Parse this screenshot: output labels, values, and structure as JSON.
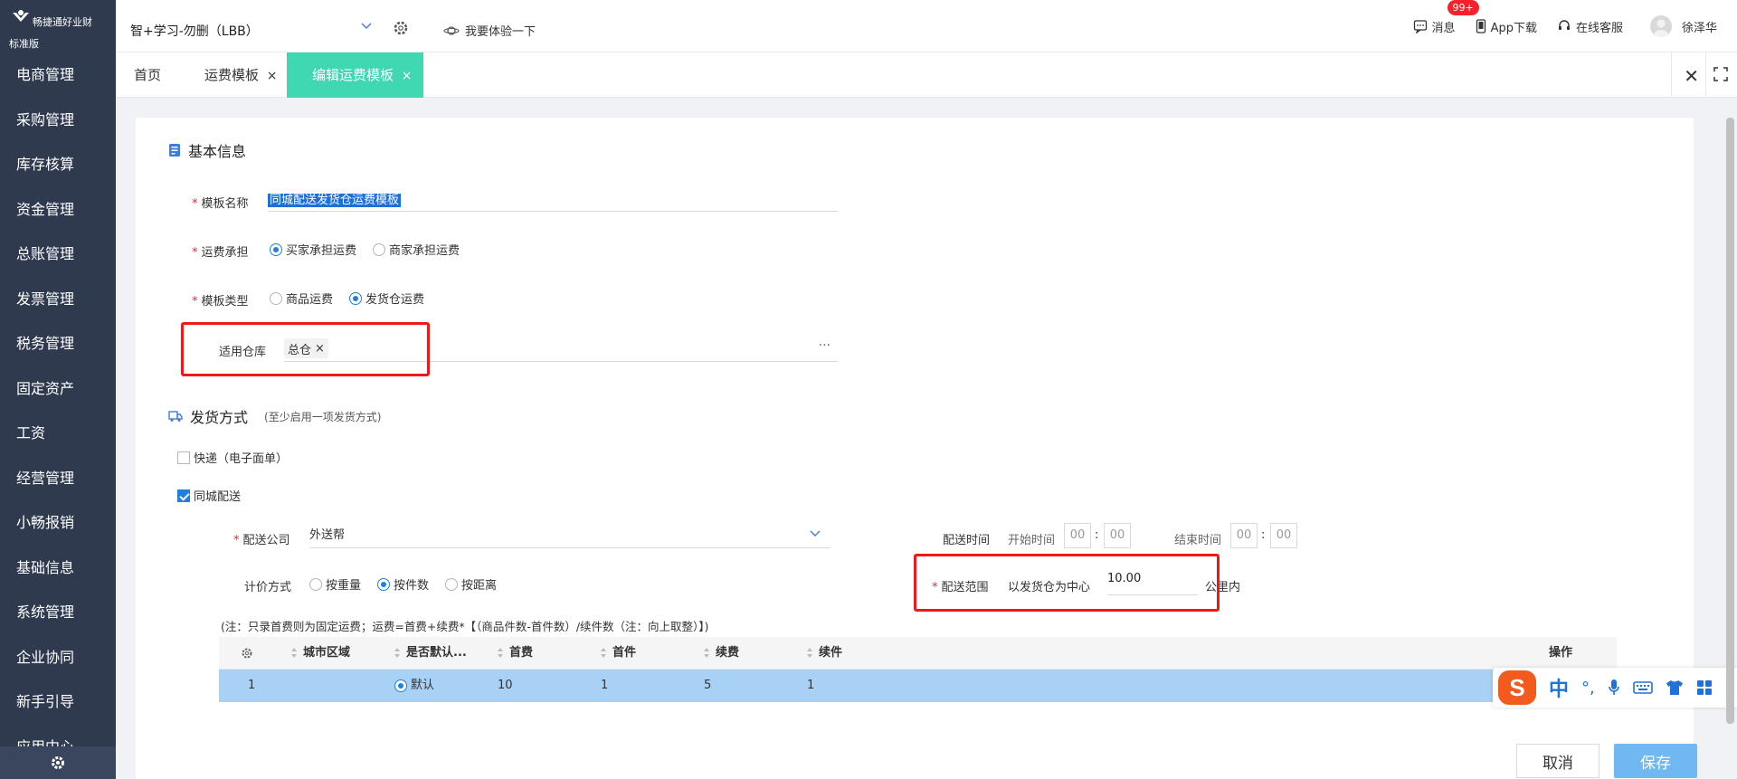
{
  "sidebar": {
    "logo_text": "畅捷通好业财",
    "edition": "标准版",
    "items": [
      {
        "label": "电商管理"
      },
      {
        "label": "采购管理"
      },
      {
        "label": "库存核算"
      },
      {
        "label": "资金管理"
      },
      {
        "label": "总账管理"
      },
      {
        "label": "发票管理"
      },
      {
        "label": "税务管理"
      },
      {
        "label": "固定资产"
      },
      {
        "label": "工资"
      },
      {
        "label": "经营管理"
      },
      {
        "label": "小畅报销"
      },
      {
        "label": "基础信息"
      },
      {
        "label": "系统管理"
      },
      {
        "label": "企业协同"
      },
      {
        "label": "新手引导"
      },
      {
        "label": "应用中心"
      }
    ]
  },
  "header": {
    "account": "智+学习-勿删（LBB）",
    "try_label": "我要体验一下",
    "messages_label": "消息",
    "messages_badge": "99+",
    "app_download": "App下载",
    "online_service": "在线客服",
    "user_name": "徐泽华"
  },
  "tabs": [
    {
      "label": "首页"
    },
    {
      "label": "运费模板",
      "close": "×"
    },
    {
      "label": "编辑运费模板",
      "close": "×"
    }
  ],
  "basic": {
    "title": "基本信息",
    "template_name_label": "模板名称",
    "template_name_value": "同城配送发货仓运费模板",
    "bearer_label": "运费承担",
    "bearer_options": [
      "买家承担运费",
      "商家承担运费"
    ],
    "type_label": "模板类型",
    "type_options": [
      "商品运费",
      "发货仓运费"
    ],
    "warehouse_label": "适用仓库",
    "warehouse_tag": "总仓",
    "warehouse_more": "···"
  },
  "shipping": {
    "title": "发货方式",
    "subtitle": "(至少启用一项发货方式)",
    "express_label": "快递（电子面单）",
    "local_label": "同城配送",
    "company_label": "配送公司",
    "company_value": "外送帮",
    "pricing_label": "计价方式",
    "pricing_options": [
      "按重量",
      "按件数",
      "按距离"
    ],
    "time_label": "配送时间",
    "start_label": "开始时间",
    "end_label": "结束时间",
    "time_placeholder": "00",
    "range_label": "配送范围",
    "range_prefix": "以发货仓为中心",
    "range_value": "10.00",
    "range_unit": "公里内",
    "note": "(注：只录首费则为固定运费；运费=首费+续费*【（商品件数-首件数）/续件数（注：向上取整）】)"
  },
  "table": {
    "headers": [
      "城市区域",
      "是否默认...",
      "首费",
      "首件",
      "续费",
      "续件",
      "操作"
    ],
    "rows": [
      {
        "index": "1",
        "default_label": "默认",
        "first_fee": "10",
        "first_item": "1",
        "cont_fee": "5",
        "cont_item": "1"
      }
    ]
  },
  "ime": {
    "logo": "S",
    "mode": "中",
    "punct": "°,"
  },
  "footer": {
    "cancel": "取消",
    "save": "保存"
  }
}
